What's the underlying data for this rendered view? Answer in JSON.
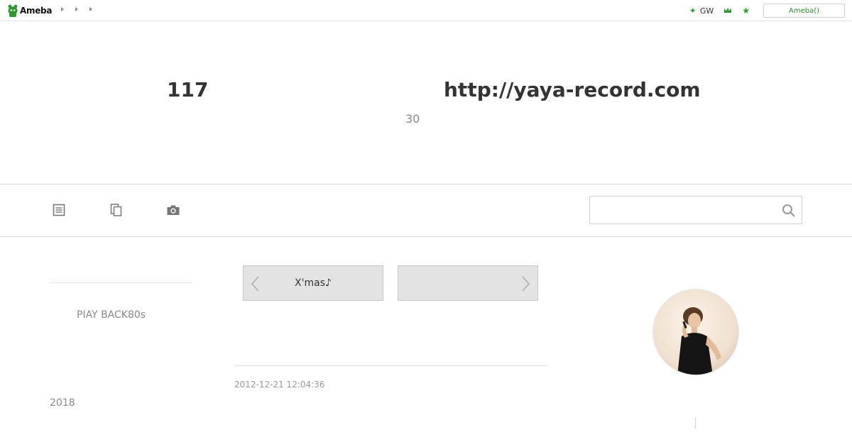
{
  "global_header": {
    "logo_text": "Ameba",
    "breadcrumb_count": 3,
    "gw_label": "GW",
    "ameba_button_label": "Ameba()"
  },
  "blog": {
    "title_left": "117",
    "title_right": "http://yaya-record.com",
    "subtitle": "30"
  },
  "nav": {
    "icons": [
      "entry-list-icon",
      "theme-list-icon",
      "photo-icon"
    ],
    "search_value": "",
    "search_placeholder": ""
  },
  "sidebar_left": {
    "item_label": "PIAY BACK80s",
    "year_label": "2018"
  },
  "article": {
    "prev_label": "X'mas♪",
    "next_label": "",
    "date": "2012-12-21 12:04:36"
  },
  "colors": {
    "ameba_green": "#2d9c2d",
    "pager_bg": "#e3e3e3",
    "muted_text": "#888888"
  }
}
